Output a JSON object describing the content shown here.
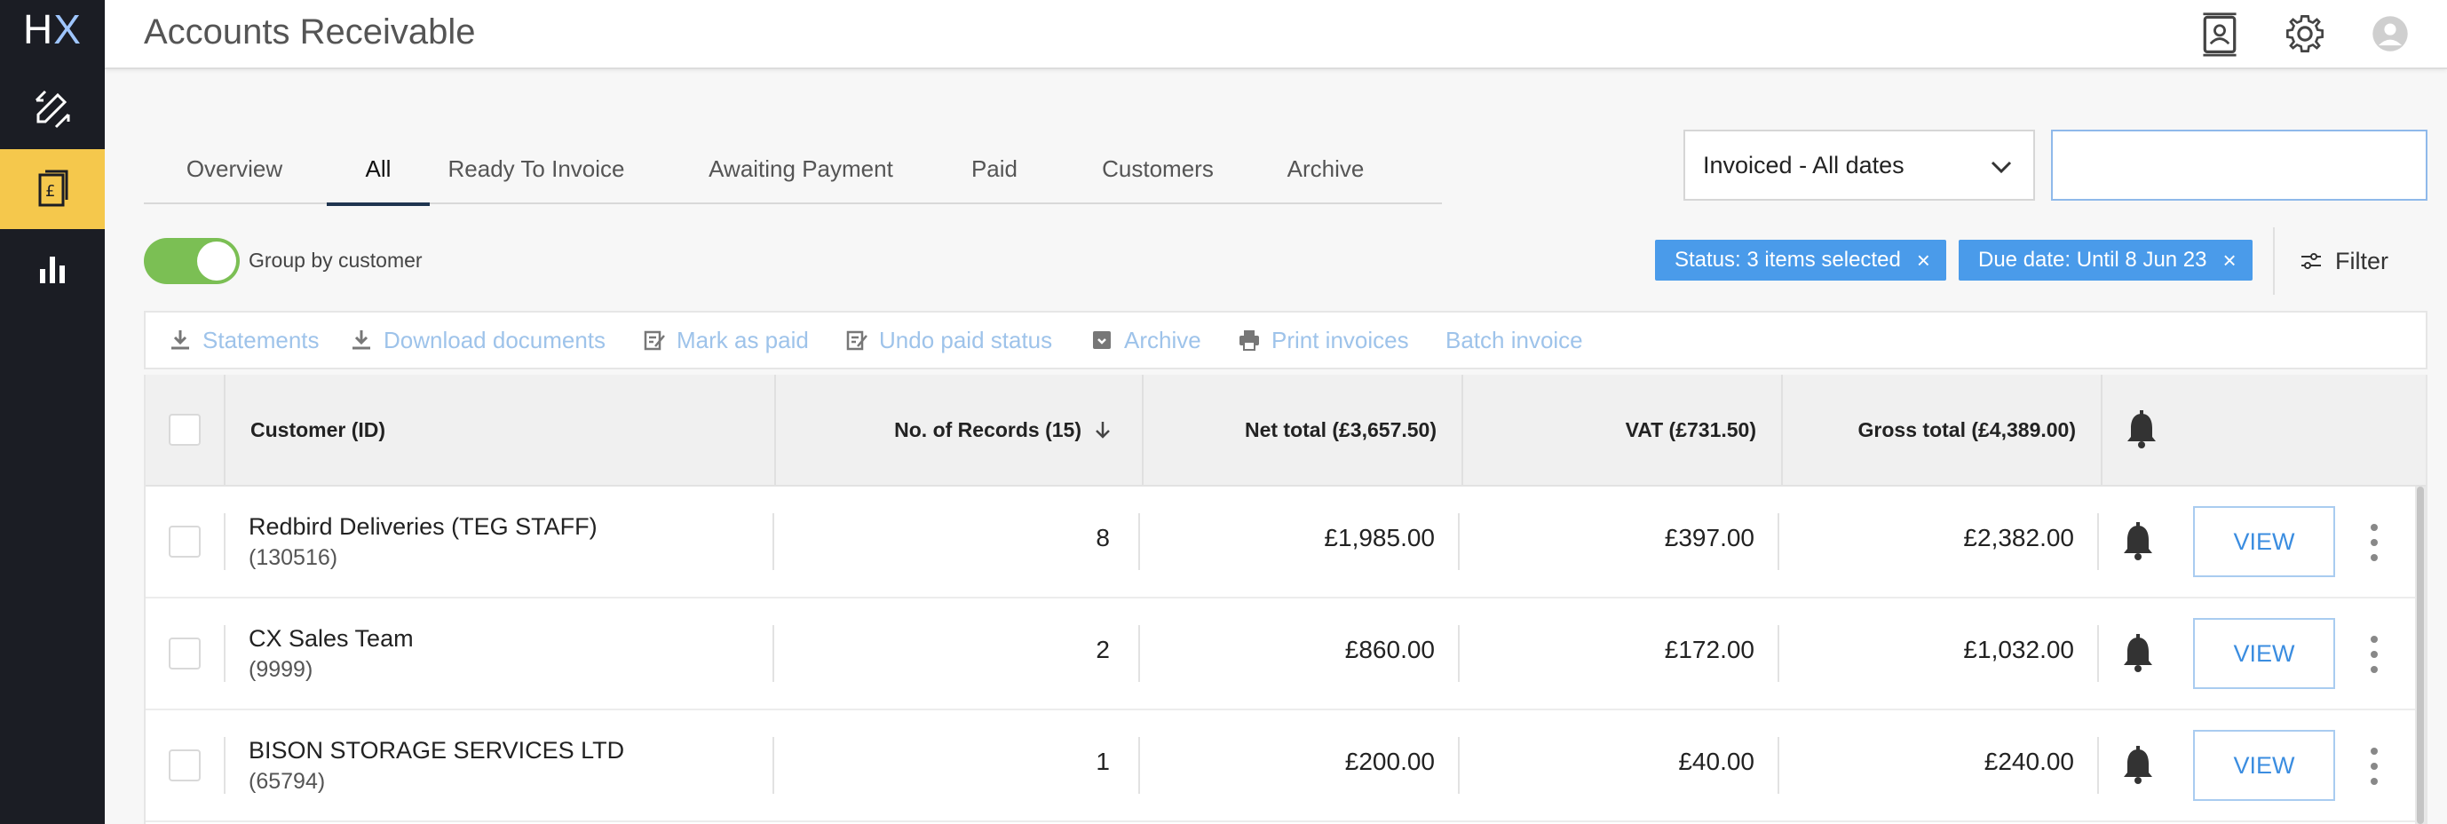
{
  "app": {
    "logo_h": "H",
    "logo_x": "X",
    "title": "Accounts Receivable"
  },
  "rail": {
    "items": [
      {
        "icon": "edit-arrows-icon"
      },
      {
        "icon": "invoice-pound-icon",
        "active": true
      },
      {
        "icon": "bar-chart-icon"
      }
    ],
    "active_color": "#f5c84c"
  },
  "tabs": [
    {
      "label": "Overview"
    },
    {
      "label": "All",
      "active": true
    },
    {
      "label": "Ready To Invoice"
    },
    {
      "label": "Awaiting Payment"
    },
    {
      "label": "Paid"
    },
    {
      "label": "Customers"
    },
    {
      "label": "Archive"
    }
  ],
  "date_filter": {
    "selected": "Invoiced - All dates"
  },
  "search": {
    "value": "",
    "placeholder": ""
  },
  "group_toggle": {
    "label": "Group by customer",
    "on": true
  },
  "chips": [
    {
      "label": "Status: 3 items selected",
      "remove": "×"
    },
    {
      "label": "Due date: Until 8 Jun 23",
      "remove": "×"
    }
  ],
  "filter_label": "Filter",
  "actions": [
    {
      "label": "Statements",
      "icon": "download-icon"
    },
    {
      "label": "Download documents",
      "icon": "download-icon"
    },
    {
      "label": "Mark as paid",
      "icon": "edit-note-icon"
    },
    {
      "label": "Undo paid status",
      "icon": "edit-note-icon"
    },
    {
      "label": "Archive",
      "icon": "archive-icon"
    },
    {
      "label": "Print invoices",
      "icon": "printer-icon"
    },
    {
      "label": "Batch invoice",
      "icon": ""
    }
  ],
  "table": {
    "headers": {
      "customer": "Customer (ID)",
      "records": "No. of Records (15)",
      "net": "Net total (£3,657.50)",
      "vat": "VAT (£731.50)",
      "gross": "Gross total (£4,389.00)"
    },
    "view_label": "VIEW",
    "rows": [
      {
        "name": "Redbird Deliveries (TEG STAFF)",
        "id": "(130516)",
        "records": "8",
        "net": "£1,985.00",
        "vat": "£397.00",
        "gross": "£2,382.00"
      },
      {
        "name": "CX Sales Team",
        "id": "(9999)",
        "records": "2",
        "net": "£860.00",
        "vat": "£172.00",
        "gross": "£1,032.00"
      },
      {
        "name": "BISON STORAGE SERVICES LTD",
        "id": "(65794)",
        "records": "1",
        "net": "£200.00",
        "vat": "£40.00",
        "gross": "£240.00"
      }
    ]
  },
  "colors": {
    "accent": "#4a9bea",
    "toggle_on": "#7bbf54",
    "rail_bg": "#1b1d24",
    "link_disabled": "#9ec3ea"
  }
}
